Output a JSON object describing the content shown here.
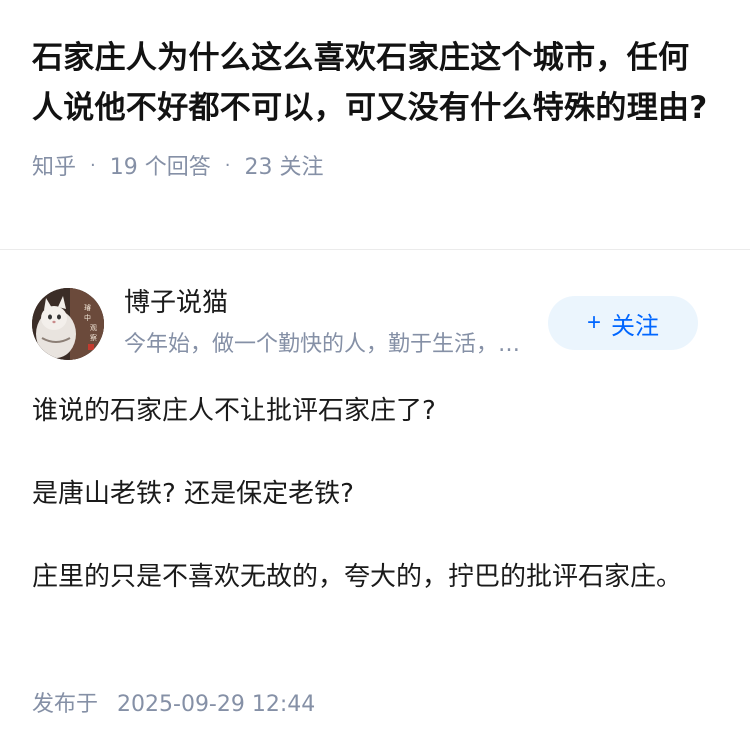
{
  "question": {
    "title": "石家庄人为什么这么喜欢石家庄这个城市，任何人说他不好都不可以，可又没有什么特殊的理由?",
    "source": "知乎",
    "answers": "19 个回答",
    "followers": "23 关注",
    "separator": "·"
  },
  "author": {
    "name": "博子说猫",
    "bio": "今年始，做一个勤快的人，勤于生活，勤于写作",
    "avatar_text": "璿中观察",
    "follow_label": "关注",
    "follow_icon": "plus-icon"
  },
  "answer": {
    "paragraphs": [
      "谁说的石家庄人不让批评石家庄了?",
      "是唐山老铁? 还是保定老铁?",
      "庄里的只是不喜欢无故的，夸大的，拧巴的批评石家庄。"
    ],
    "publish_label": "发布于",
    "publish_time": "2025-09-29 12:44"
  },
  "colors": {
    "accent": "#0066ff",
    "follow_bg": "#ebf5fd",
    "meta_gray": "#8590a6"
  }
}
